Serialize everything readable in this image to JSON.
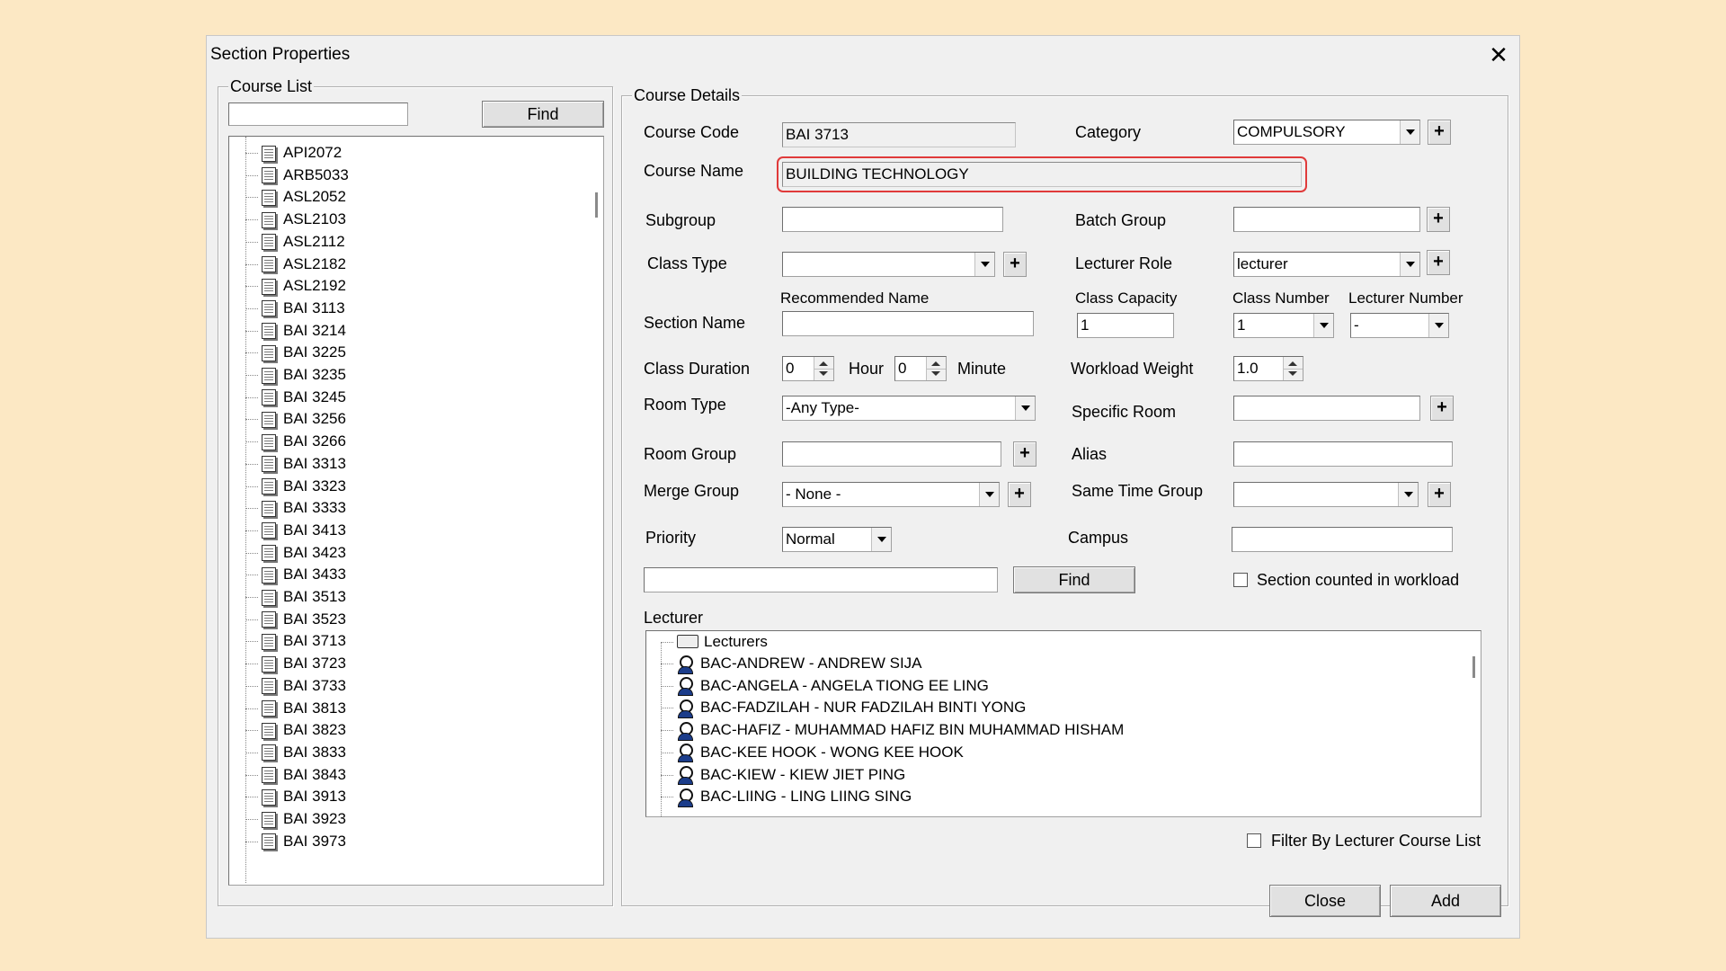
{
  "window": {
    "title": "Section Properties"
  },
  "course_list": {
    "group_label": "Course List",
    "search_value": "",
    "find_label": "Find",
    "items": [
      "API2072",
      "ARB5033",
      "ASL2052",
      "ASL2103",
      "ASL2112",
      "ASL2182",
      "ASL2192",
      "BAI 3113",
      "BAI 3214",
      "BAI 3225",
      "BAI 3235",
      "BAI 3245",
      "BAI 3256",
      "BAI 3266",
      "BAI 3313",
      "BAI 3323",
      "BAI 3333",
      "BAI 3413",
      "BAI 3423",
      "BAI 3433",
      "BAI 3513",
      "BAI 3523",
      "BAI 3713",
      "BAI 3723",
      "BAI 3733",
      "BAI 3813",
      "BAI 3823",
      "BAI 3833",
      "BAI 3843",
      "BAI 3913",
      "BAI 3923",
      "BAI 3973"
    ]
  },
  "details": {
    "group_label": "Course Details",
    "course_code": {
      "label": "Course Code",
      "value": "BAI 3713"
    },
    "course_name": {
      "label": "Course Name",
      "value": "BUILDING TECHNOLOGY"
    },
    "category": {
      "label": "Category",
      "value": "COMPULSORY"
    },
    "subgroup": {
      "label": "Subgroup",
      "value": ""
    },
    "batch_group": {
      "label": "Batch Group",
      "value": ""
    },
    "class_type": {
      "label": "Class Type",
      "value": ""
    },
    "lecturer_role": {
      "label": "Lecturer Role",
      "value": "lecturer"
    },
    "recommended_name": {
      "label": "Recommended Name"
    },
    "section_name": {
      "label": "Section Name",
      "value": ""
    },
    "class_capacity": {
      "label": "Class Capacity",
      "value": "1"
    },
    "class_number": {
      "label": "Class Number",
      "value": "1"
    },
    "lecturer_number": {
      "label": "Lecturer Number",
      "value": "-"
    },
    "class_duration": {
      "label": "Class Duration",
      "hour_value": "0",
      "hour_label": "Hour",
      "minute_value": "0",
      "minute_label": "Minute"
    },
    "workload_weight": {
      "label": "Workload Weight",
      "value": "1.0"
    },
    "room_type": {
      "label": "Room Type",
      "value": "-Any Type-"
    },
    "specific_room": {
      "label": "Specific Room",
      "value": ""
    },
    "room_group": {
      "label": "Room Group",
      "value": ""
    },
    "alias": {
      "label": "Alias",
      "value": ""
    },
    "merge_group": {
      "label": "Merge Group",
      "value": "- None -"
    },
    "same_time_group": {
      "label": "Same Time Group",
      "value": ""
    },
    "priority": {
      "label": "Priority",
      "value": "Normal"
    },
    "campus": {
      "label": "Campus",
      "value": ""
    },
    "lecturer_search_value": "",
    "find_label": "Find",
    "workload_checkbox_label": "Section counted in workload",
    "lecturer_label": "Lecturer",
    "lecturer_root": "Lecturers",
    "lecturers": [
      "BAC-ANDREW - ANDREW SIJA",
      "BAC-ANGELA - ANGELA TIONG EE LING",
      "BAC-FADZILAH - NUR FADZILAH BINTI YONG",
      "BAC-HAFIZ - MUHAMMAD HAFIZ BIN MUHAMMAD HISHAM",
      "BAC-KEE HOOK - WONG KEE HOOK",
      "BAC-KIEW - KIEW JIET PING",
      "BAC-LIING - LING LIING SING"
    ],
    "filter_label": "Filter By Lecturer Course List"
  },
  "buttons": {
    "close": "Close",
    "add": "Add",
    "plus": "+"
  }
}
